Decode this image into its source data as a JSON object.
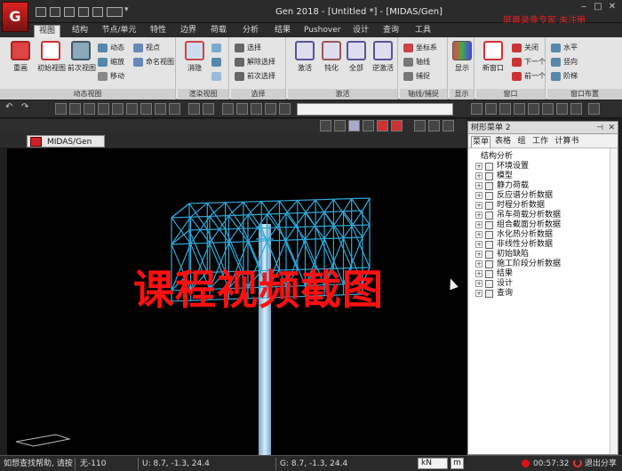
{
  "app": {
    "logo_letter": "G",
    "title": "Gen 2018 - [Untitled *] - [MIDAS/Gen]",
    "watermark_top": "屏幕录像专家 未注册"
  },
  "window_controls": {
    "minimize": "‒",
    "maximize": "□",
    "close": "✕"
  },
  "ribbon_tabs": [
    {
      "label": "视图",
      "active": true
    },
    {
      "label": "结构"
    },
    {
      "label": "节点/单元"
    },
    {
      "label": "特性"
    },
    {
      "label": "边界"
    },
    {
      "label": "荷载"
    },
    {
      "label": "分析"
    },
    {
      "label": "结果"
    },
    {
      "label": "Pushover"
    },
    {
      "label": "设计"
    },
    {
      "label": "查询"
    },
    {
      "label": "工具"
    }
  ],
  "ribbon": {
    "dynamic_view": {
      "label": "动态视图",
      "redraw": "重画",
      "initial": "初始视图",
      "prev": "前次视图",
      "rotate": "动态",
      "zoom": "缩放",
      "move": "移动",
      "viewpoint": "视点",
      "named": "命名视图"
    },
    "render_view": {
      "label": "渲染视图",
      "hide": "消隐"
    },
    "select": {
      "label": "选择",
      "select": "选择",
      "deselect": "解除选择",
      "prev_select": "前次选择"
    },
    "activate": {
      "label": "激活",
      "activate": "激活",
      "passivate": "钝化",
      "all": "全部",
      "inverse": "逆激活"
    },
    "grid_snap": {
      "label": "轴线/捕捉",
      "coord": "坐标系",
      "axis": "轴线",
      "snap": "捕捉"
    },
    "display": {
      "label": "显示",
      "display": "显示"
    },
    "window": {
      "label": "窗口",
      "new": "新窗口",
      "close": "关闭",
      "next": "下一个",
      "prev": "前一个"
    },
    "window_layout": {
      "label": "窗口布置",
      "horizontal": "水平",
      "vertical": "竖向",
      "cascade": "阶梯"
    }
  },
  "doc_tab": {
    "label": "MIDAS/Gen"
  },
  "viewport": {
    "watermark": "课程视频截图",
    "background": "#000000",
    "model_color": "#2fa8d8",
    "pole_color": "#b8d8ee"
  },
  "panel": {
    "title": "树形菜单 2",
    "pin": "⊣",
    "close": "✕",
    "tabs": [
      {
        "label": "菜单",
        "active": true
      },
      {
        "label": "表格"
      },
      {
        "label": "组"
      },
      {
        "label": "工作"
      },
      {
        "label": "计算书"
      }
    ],
    "root": "结构分析",
    "items": [
      "环境设置",
      "模型",
      "静力荷载",
      "反应谱分析数据",
      "时程分析数据",
      "吊车荷载分析数据",
      "组合截面分析数据",
      "水化热分析数据",
      "非线性分析数据",
      "初始缺陷",
      "施工阶段分析数据",
      "结果",
      "设计",
      "查询"
    ]
  },
  "statusbar": {
    "help": "如想查找帮助, 请按",
    "none": "无-110",
    "u_coord": "U: 8.7, -1.3, 24.4",
    "g_coord": "G: 8.7, -1.3, 24.4",
    "unit": "kN",
    "unit2": "m",
    "timer": "00:57:32",
    "exit": "退出分享"
  }
}
